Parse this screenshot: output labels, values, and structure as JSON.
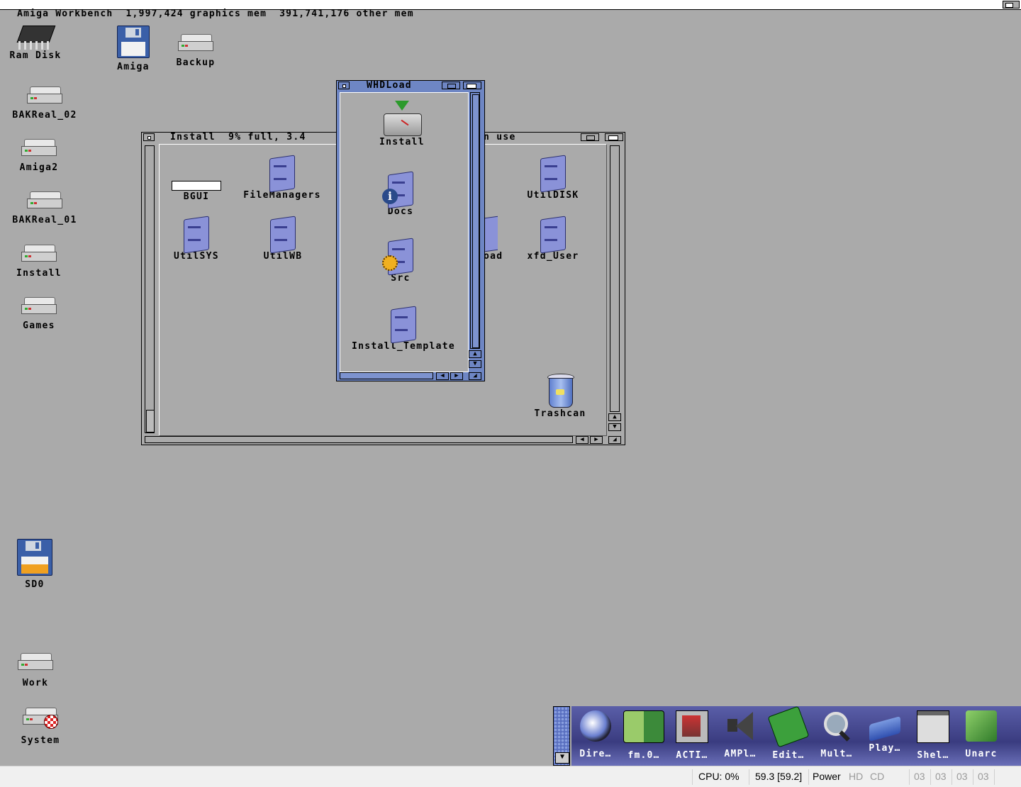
{
  "screen_title": "Amiga Workbench  1,997,424 graphics mem  391,741,176 other mem",
  "desktop_icons": {
    "ram_disk": "Ram Disk",
    "amiga": "Amiga",
    "backup": "Backup",
    "bakreal_02": "BAKReal_02",
    "amiga2": "Amiga2",
    "bakreal_01": "BAKReal_01",
    "install": "Install",
    "games": "Games",
    "sd0": "SD0",
    "work": "Work",
    "system": "System"
  },
  "install_window": {
    "title_left": "Install  9% full, 3.4",
    "title_right": "n use",
    "icons": {
      "bgui": "BGUI",
      "filemanagers": "FileManagers",
      "utildisk": "UtilDISK",
      "utilsys": "UtilSYS",
      "utilwb": "UtilWB",
      "load_partial": "oad",
      "xfd_user": "xfd_User",
      "trashcan": "Trashcan"
    }
  },
  "whdload_window": {
    "title": "WHDLoad",
    "icons": {
      "install": "Install",
      "docs": "Docs",
      "src": "Src",
      "install_template": "Install_Template"
    }
  },
  "dock": {
    "items": [
      "Dire…",
      "fm.0…",
      "ACTI…",
      "AMPl…",
      "Edit…",
      "Mult…",
      "Play…",
      "Shel…",
      "Unarc"
    ]
  },
  "status_bar": {
    "cpu": "CPU: 0%",
    "fps": "59.3 [59.2]",
    "power": "Power",
    "hd": "HD",
    "cd": "CD",
    "drives": [
      "03",
      "03",
      "03",
      "03"
    ]
  }
}
